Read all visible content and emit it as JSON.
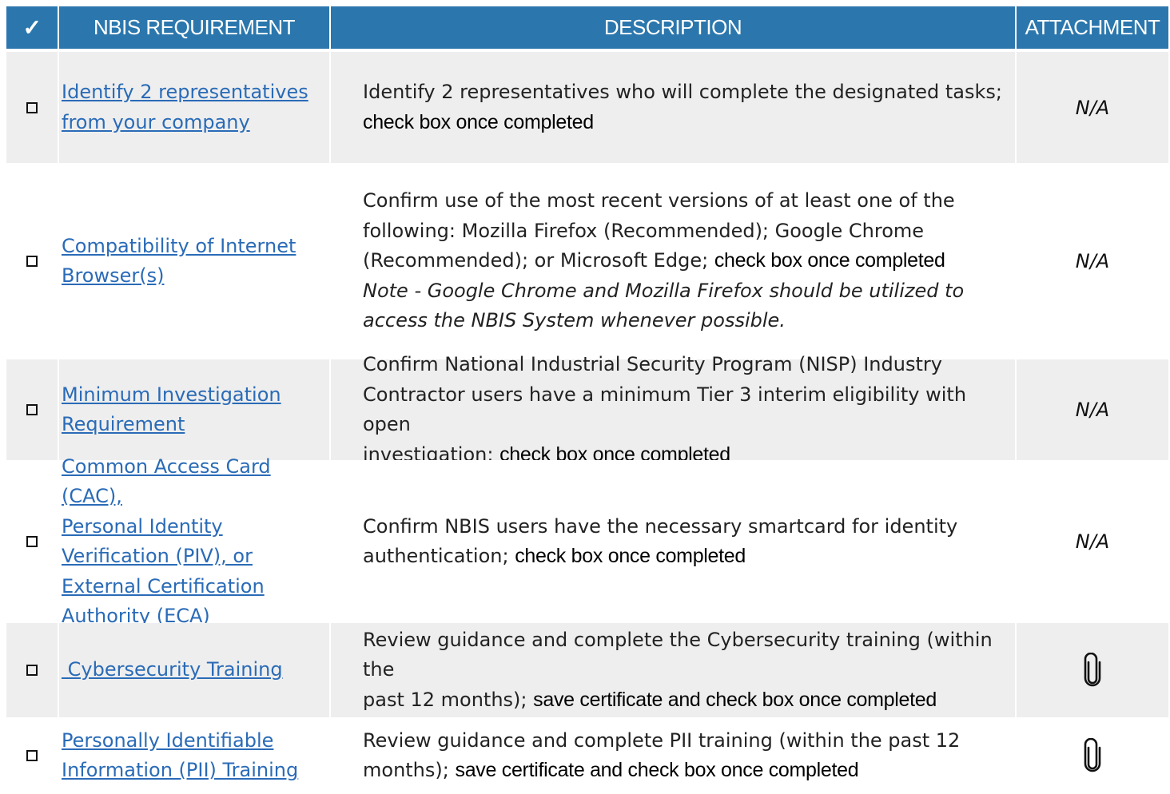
{
  "header": {
    "check_symbol": "✓",
    "requirement": "NBIS REQUIREMENT",
    "description": "DESCRIPTION",
    "attachment": "ATTACHMENT"
  },
  "rows": [
    {
      "requirement_lines": [
        "Identify 2 representatives",
        "from your company"
      ],
      "description_lines": [
        "Identify 2 representatives who will complete the designated tasks;"
      ],
      "description_emphasis": "check box once completed",
      "attachment": "N/A"
    },
    {
      "requirement_lines": [
        "Compatibility of Internet",
        "Browser(s)"
      ],
      "description_lines": [
        "Confirm use of the most recent versions of at least one of the",
        "following: Mozilla Firefox (Recommended); Google Chrome",
        "(Recommended); or Microsoft Edge;"
      ],
      "description_emphasis": "check box once completed",
      "description_note_lines": [
        "Note - Google Chrome and Mozilla Firefox should be utilized to",
        "access the NBIS System whenever possible."
      ],
      "attachment": "N/A"
    },
    {
      "requirement_lines": [
        "Minimum Investigation",
        "Requirement"
      ],
      "description_lines": [
        "Confirm National Industrial Security Program (NISP) Industry",
        "Contractor users have a minimum Tier 3 interim eligibility with open",
        "investigation;"
      ],
      "description_emphasis": "check box once completed",
      "attachment": "N/A"
    },
    {
      "requirement_lines": [
        "Common Access Card (CAC),",
        "Personal Identity",
        "Verification (PIV), or",
        "External Certification",
        "Authority (ECA)"
      ],
      "description_lines": [
        "Confirm NBIS users have the necessary smartcard for identity",
        "authentication;"
      ],
      "description_emphasis": "check box once completed",
      "attachment": "N/A"
    },
    {
      "requirement_lines": [
        " Cybersecurity Training"
      ],
      "description_lines": [
        "Review guidance and complete the Cybersecurity training (within the",
        "past 12 months);"
      ],
      "description_emphasis": "save certificate and check box once completed",
      "attachment_icon": "paperclip-icon"
    },
    {
      "requirement_lines": [
        "Personally Identifiable",
        "Information (PII) Training"
      ],
      "description_lines": [
        "Review guidance and complete PII training (within the past 12",
        "months);"
      ],
      "description_emphasis": "save certificate and check box once completed",
      "attachment_icon": "paperclip-icon"
    }
  ]
}
